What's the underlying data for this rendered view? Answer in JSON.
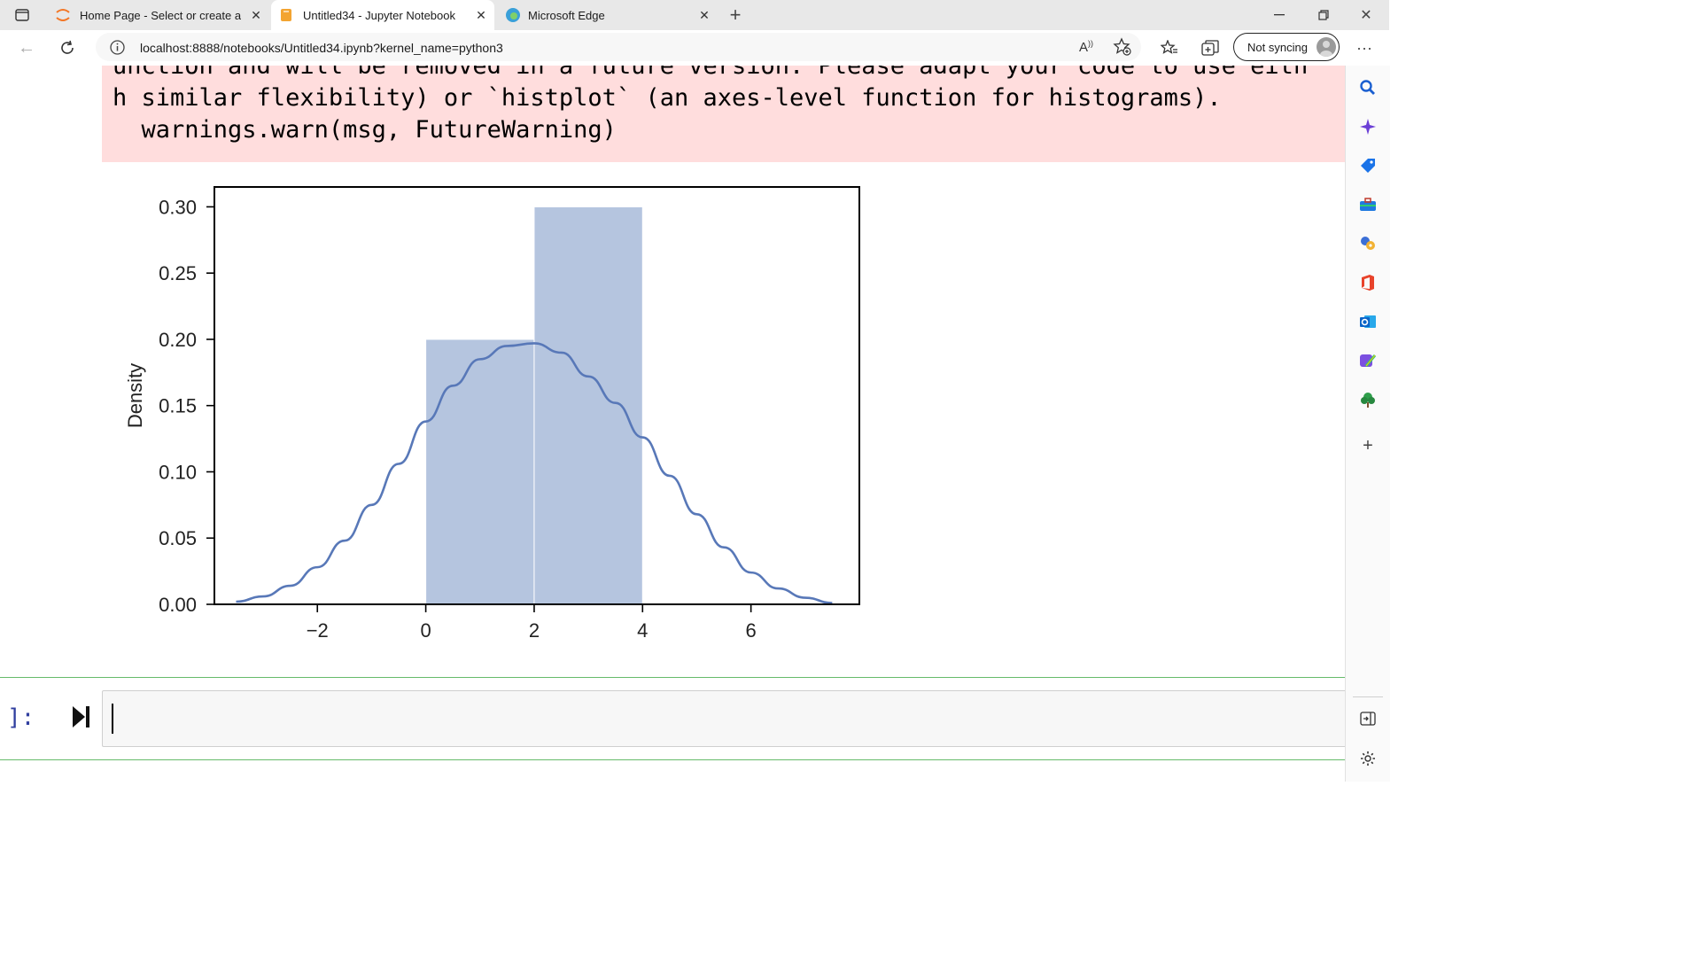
{
  "browser": {
    "tabs": [
      {
        "title": "Home Page - Select or create a n"
      },
      {
        "title": "Untitled34 - Jupyter Notebook"
      },
      {
        "title": "Microsoft Edge"
      }
    ],
    "url": "localhost:8888/notebooks/Untitled34.ipynb?kernel_name=python3",
    "sync_label": "Not syncing"
  },
  "output": {
    "warning_lines": [
      "unction and will be removed in a future version. Please adapt your code to use eith",
      "h similar flexibility) or `histplot` (an axes-level function for histograms).",
      "  warnings.warn(msg, FutureWarning)"
    ]
  },
  "chart_data": {
    "type": "bar",
    "title": "",
    "xlabel": "",
    "ylabel": "Density",
    "bins": [
      {
        "x0": 0,
        "x1": 2,
        "density": 0.2
      },
      {
        "x0": 2,
        "x1": 4,
        "density": 0.3
      }
    ],
    "kde": {
      "x": [
        -3.5,
        -3,
        -2.5,
        -2,
        -1.5,
        -1,
        -0.5,
        0,
        0.5,
        1,
        1.5,
        2,
        2.5,
        3,
        3.5,
        4,
        4.5,
        5,
        5.5,
        6,
        6.5,
        7,
        7.5
      ],
      "y": [
        0.002,
        0.006,
        0.014,
        0.028,
        0.048,
        0.075,
        0.106,
        0.138,
        0.165,
        0.185,
        0.195,
        0.197,
        0.19,
        0.172,
        0.152,
        0.126,
        0.097,
        0.068,
        0.043,
        0.024,
        0.012,
        0.005,
        0.001
      ]
    },
    "xlim": [
      -3.9,
      8.0
    ],
    "ylim": [
      0,
      0.315
    ],
    "xticks": [
      -2,
      0,
      2,
      4,
      6
    ],
    "xtick_labels": [
      "−2",
      "0",
      "2",
      "4",
      "6"
    ],
    "yticks": [
      0.0,
      0.05,
      0.1,
      0.15,
      0.2,
      0.25,
      0.3
    ],
    "ytick_labels": [
      "0.00",
      "0.05",
      "0.10",
      "0.15",
      "0.20",
      "0.25",
      "0.30"
    ],
    "colors": {
      "bar": "#b5c5df",
      "line": "#5878b8",
      "frame": "#000000"
    }
  },
  "cell": {
    "prompt": "]:"
  }
}
